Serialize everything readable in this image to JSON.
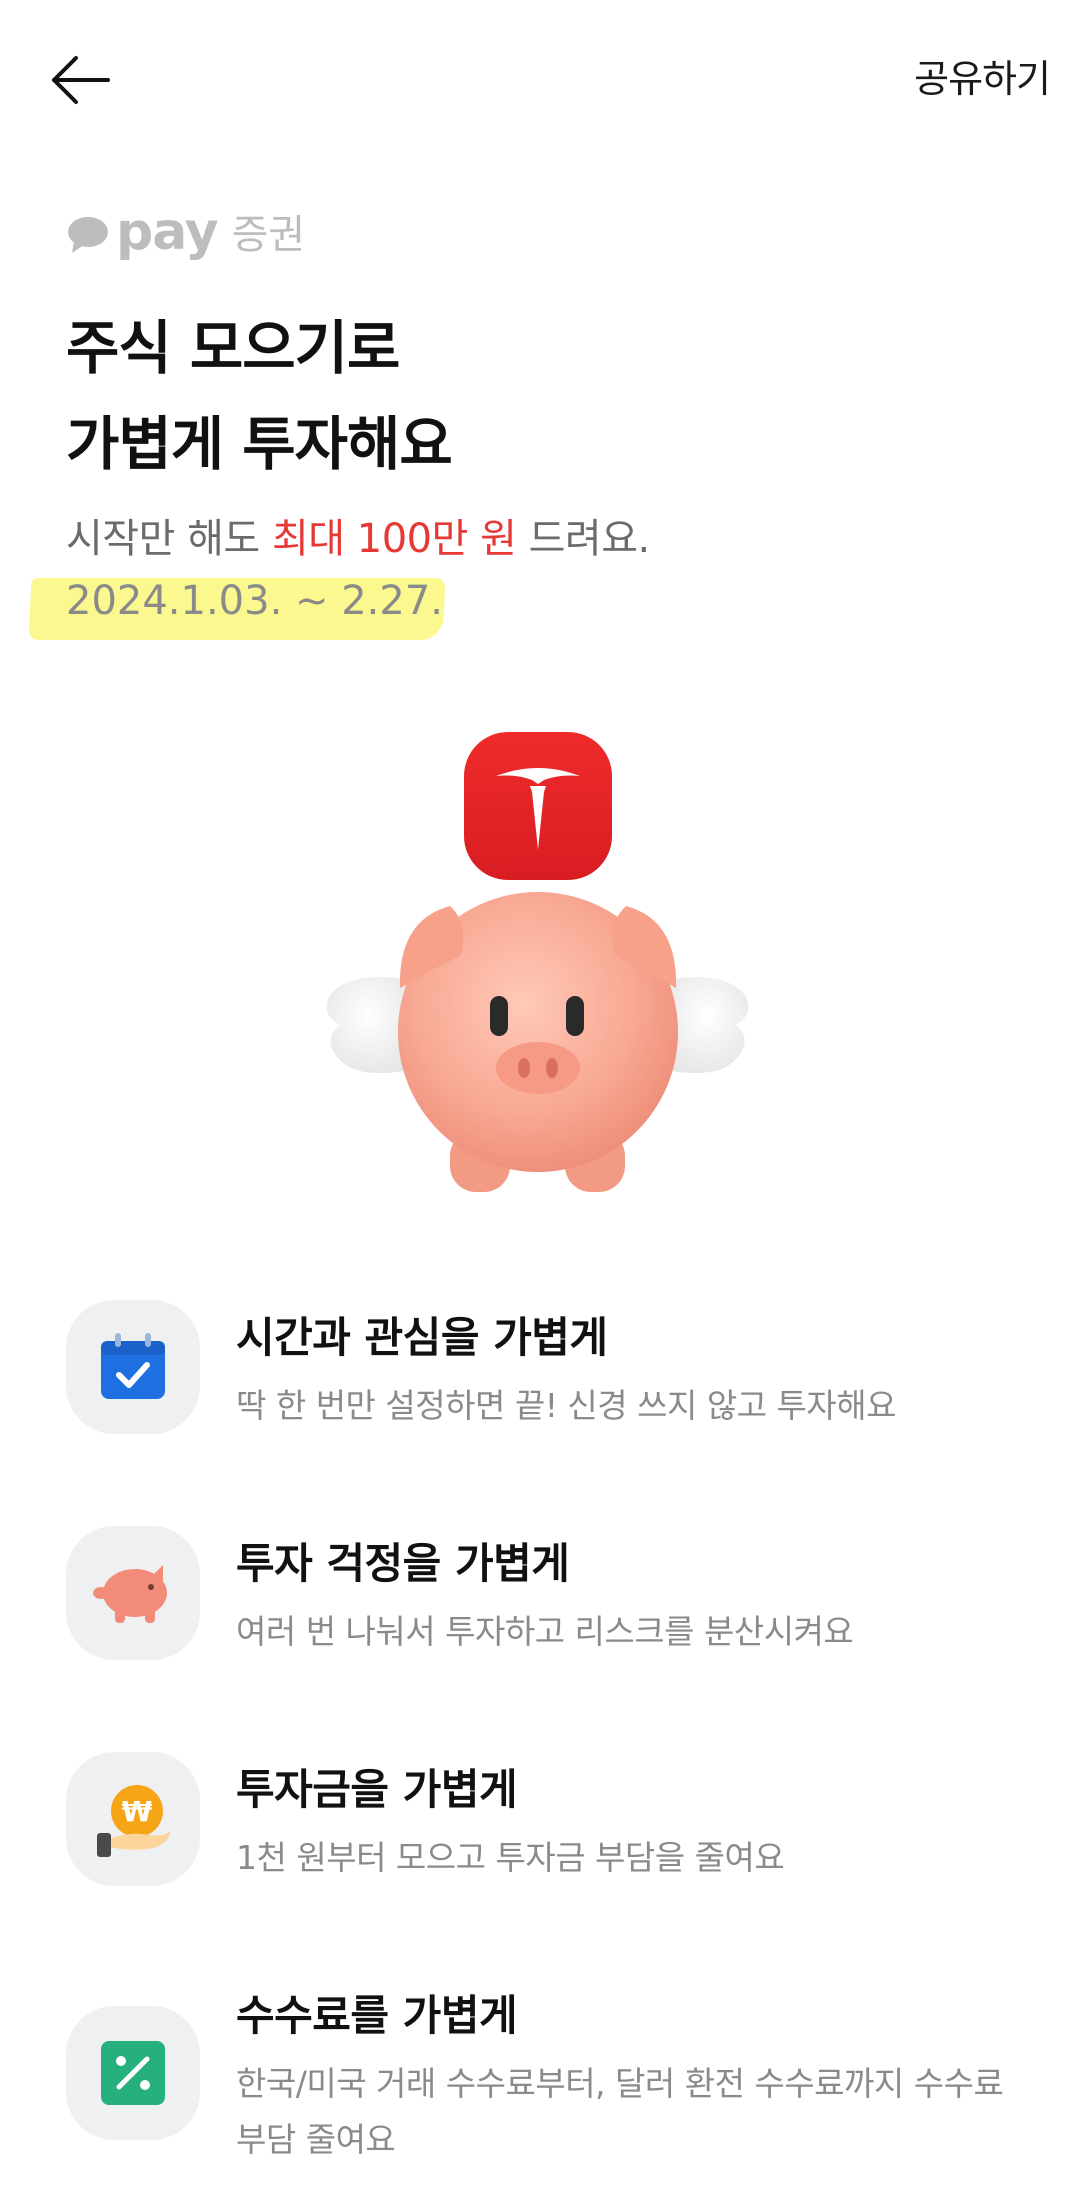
{
  "header": {
    "share_label": "공유하기"
  },
  "brand": {
    "pay": "pay",
    "securities": "증권"
  },
  "headline": {
    "line1": "주식 모으기로",
    "line2": "가볍게 투자해요"
  },
  "subline": {
    "prefix": "시작만 해도 ",
    "highlight": "최대 100만 원",
    "suffix": " 드려요."
  },
  "period": "2024.1.03. ~ 2.27.",
  "colors": {
    "accent_red": "#e53935",
    "tesla_red": "#e82127",
    "highlight_yellow": "#f9f77a",
    "calendar_blue": "#1e6fe0",
    "fee_green": "#26b07e"
  },
  "features": [
    {
      "icon": "calendar-check-icon",
      "title": "시간과 관심을 가볍게",
      "desc": "딱 한 번만 설정하면 끝! 신경 쓰지 않고 투자해요"
    },
    {
      "icon": "piggy-bank-icon",
      "title": "투자 걱정을 가볍게",
      "desc": "여러 번 나눠서 투자하고 리스크를 분산시켜요"
    },
    {
      "icon": "won-coin-hand-icon",
      "title": "투자금을 가볍게",
      "desc": "1천 원부터 모으고 투자금 부담을 줄여요"
    },
    {
      "icon": "percent-fee-icon",
      "title": "수수료를 가볍게",
      "desc": "한국/미국 거래 수수료부터, 달러 환전 수수료까지 수수료 부담 줄여요"
    }
  ]
}
